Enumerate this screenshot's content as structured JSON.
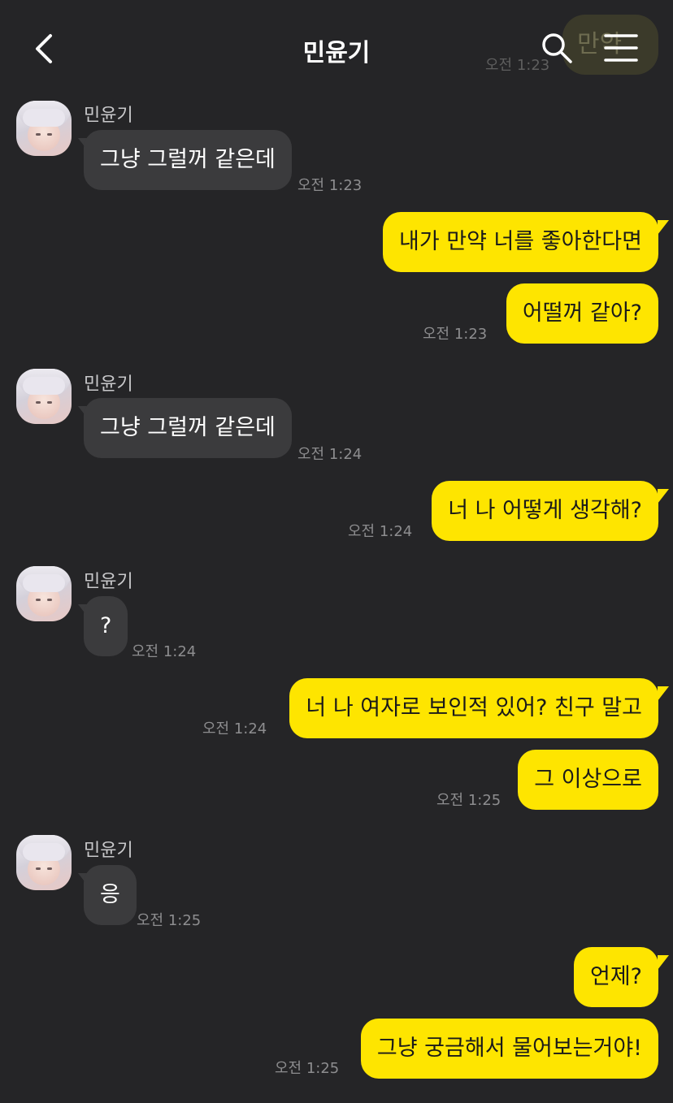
{
  "header": {
    "title": "민윤기",
    "back_icon": "chevron-left-icon",
    "search_icon": "search-icon",
    "menu_icon": "hamburger-menu-icon"
  },
  "ghost": {
    "text": "만약",
    "time": "오전 1:23"
  },
  "colors": {
    "background": "#252527",
    "incoming": "#3b3b3d",
    "outgoing": "#fee500"
  },
  "messages": [
    {
      "sender": "민윤기",
      "text": "그냥 그럴꺼 같은데",
      "time": "오전 1:23"
    },
    {
      "sender": "me",
      "text": "내가 만약 너를 좋아한다면"
    },
    {
      "sender": "me",
      "text": "어떨꺼 같아?",
      "time": "오전 1:23"
    },
    {
      "sender": "민윤기",
      "text": "그냥 그럴꺼 같은데",
      "time": "오전 1:24"
    },
    {
      "sender": "me",
      "text": "너 나 어떻게 생각해?",
      "time": "오전 1:24"
    },
    {
      "sender": "민윤기",
      "text": "?",
      "time": "오전 1:24"
    },
    {
      "sender": "me",
      "text": "너 나 여자로 보인적 있어? 친구 말고",
      "time": "오전 1:24"
    },
    {
      "sender": "me",
      "text": "그 이상으로",
      "time": "오전 1:25"
    },
    {
      "sender": "민윤기",
      "text": "응",
      "time": "오전 1:25"
    },
    {
      "sender": "me",
      "text": "언제?"
    },
    {
      "sender": "me",
      "text": "그냥 궁금해서 물어보는거야!",
      "time": "오전 1:25"
    }
  ]
}
